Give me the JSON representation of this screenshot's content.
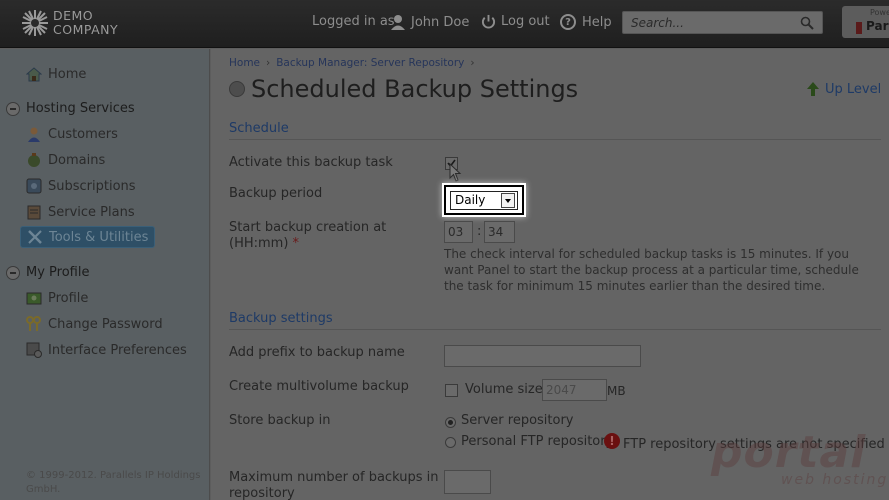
{
  "header": {
    "logo_line1": "DEMO",
    "logo_line2": "COMPANY",
    "logged_in_as": "Logged in as",
    "user_name": "John Doe",
    "logout_label": "Log out",
    "help_label": "Help",
    "search_placeholder": "Search...",
    "brand_small": "Powe",
    "brand_text": "Par"
  },
  "sidebar": {
    "home": "Home",
    "hosting_services": "Hosting Services",
    "items": [
      {
        "label": "Customers",
        "icon": "customers-icon"
      },
      {
        "label": "Domains",
        "icon": "domains-icon"
      },
      {
        "label": "Subscriptions",
        "icon": "subscriptions-icon"
      },
      {
        "label": "Service Plans",
        "icon": "service-plans-icon"
      },
      {
        "label": "Tools & Utilities",
        "icon": "tools-icon",
        "active": true
      }
    ],
    "my_profile": "My Profile",
    "profile_items": [
      {
        "label": "Profile",
        "icon": "profile-icon"
      },
      {
        "label": "Change Password",
        "icon": "keys-icon"
      },
      {
        "label": "Interface Preferences",
        "icon": "preferences-icon"
      }
    ],
    "copyright": "© 1999-2012. Parallels IP Holdings GmbH."
  },
  "main": {
    "breadcrumb": [
      "Home",
      "Backup Manager: Server Repository"
    ],
    "title": "Scheduled Backup Settings",
    "up_level": "Up Level",
    "schedule_heading": "Schedule",
    "activate_label": "Activate this backup task",
    "activate_checked": true,
    "backup_period_label": "Backup period",
    "backup_period_value": "Daily",
    "start_label_line1": "Start backup creation at",
    "start_label_line2": "(HH:mm)",
    "required_mark": "*",
    "start_hour": "03",
    "start_minute": "34",
    "time_separator": ":",
    "hint": "The check interval for scheduled backup tasks is 15 minutes. If you want Panel to start the backup process at a particular time, schedule the task for minimum 15 minutes earlier than the desired time.",
    "backup_settings_heading": "Backup settings",
    "prefix_label": "Add prefix to backup name",
    "prefix_value": "",
    "multivolume_label": "Create multivolume backup",
    "volume_size_label": "Volume size",
    "volume_size_value": "2047",
    "volume_unit": "MB",
    "store_label": "Store backup in",
    "store_option_server": "Server repository",
    "store_option_ftp": "Personal FTP repository",
    "ftp_warning": "FTP repository settings are not specified",
    "max_backups_label_line1": "Maximum number of backups in",
    "max_backups_label_line2": "repository",
    "max_backups_value": ""
  },
  "watermark": {
    "main": "portal",
    "sub": "web hosting"
  },
  "colors": {
    "active_item": "#2e4f66",
    "link": "#1e3a66",
    "warning": "#6a1010"
  }
}
